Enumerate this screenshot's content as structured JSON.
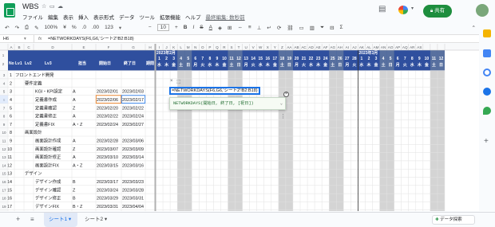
{
  "app": {
    "title": "WBS",
    "menu": [
      "ファイル",
      "編集",
      "表示",
      "挿入",
      "表示形式",
      "データ",
      "ツール",
      "拡張機能",
      "ヘルプ"
    ],
    "last_edit": "最終編集: 数秒前",
    "share_label": "共有"
  },
  "toolbar": {
    "zoom": "100%",
    "font_size": "10",
    "bold": "B",
    "italic": "I",
    "strike": "S",
    "text_color": "A"
  },
  "formula_bar": {
    "cell_ref": "H6",
    "formula": "=NETWORKDAYS(F6,G6,'シート2'!B2:B18)"
  },
  "grid": {
    "col_letters": [
      "A",
      "B",
      "C",
      "D",
      "E",
      "F",
      "G",
      "H",
      "I",
      "J",
      "K",
      "L",
      "M",
      "N",
      "O",
      "P",
      "Q",
      "R",
      "S",
      "T",
      "U",
      "V",
      "W",
      "X",
      "Y",
      "Z",
      "AA",
      "AB",
      "AC",
      "AD",
      "AE",
      "AF",
      "AG",
      "AH",
      "AI",
      "AJ",
      "AK",
      "AL",
      "AM",
      "AN",
      "AO",
      "AP",
      "AQ",
      "AR",
      "AS"
    ],
    "headers": {
      "no": "No",
      "lv1": "Lv1",
      "lv2": "Lv2",
      "lv3": "Lv3",
      "owner": "担当",
      "start": "開始日",
      "end": "終了日",
      "days": "期間"
    },
    "month_1": "2023年2月",
    "month_2": "2023年3月",
    "days_1": [
      "1",
      "2",
      "3",
      "4",
      "5",
      "6",
      "7",
      "8",
      "9",
      "10",
      "11",
      "12",
      "13",
      "14",
      "15",
      "16",
      "17",
      "18",
      "19",
      "20",
      "21",
      "22",
      "23",
      "24",
      "25",
      "26",
      "27",
      "28"
    ],
    "weekdays_1": [
      "水",
      "木",
      "金",
      "土",
      "日",
      "月",
      "火",
      "水",
      "木",
      "金",
      "土",
      "日",
      "月",
      "火",
      "水",
      "木",
      "金",
      "土",
      "日",
      "月",
      "火",
      "水",
      "木",
      "金",
      "土",
      "日",
      "月",
      "火"
    ],
    "days_2": [
      "1",
      "2",
      "3",
      "4",
      "5",
      "6",
      "7",
      "8",
      "9",
      "10",
      "11",
      "12"
    ],
    "weekdays_2": [
      "水",
      "木",
      "金",
      "土",
      "日",
      "月",
      "火",
      "水",
      "木",
      "金",
      "土",
      "日"
    ],
    "rows": [
      {
        "r": "3",
        "no": "1",
        "lv1": "フロントエンド開発",
        "lv2": "",
        "lv3": "",
        "owner": "",
        "start": "",
        "end": ""
      },
      {
        "r": "4",
        "no": "2",
        "lv1": "",
        "lv2": "要件定義",
        "lv3": "",
        "owner": "",
        "start": "",
        "end": ""
      },
      {
        "r": "5",
        "no": "3",
        "lv1": "",
        "lv2": "",
        "lv3": "KGI・KPI設定",
        "owner": "A",
        "start": "2023/02/01",
        "end": "2023/02/03"
      },
      {
        "r": "6",
        "no": "4",
        "lv1": "",
        "lv2": "",
        "lv3": "定義書作成",
        "owner": "A",
        "start": "2023/02/06",
        "end": "2023/02/17"
      },
      {
        "r": "7",
        "no": "5",
        "lv1": "",
        "lv2": "",
        "lv3": "定義書確認",
        "owner": "Z",
        "start": "2023/02/20",
        "end": "2023/02/22"
      },
      {
        "r": "8",
        "no": "6",
        "lv1": "",
        "lv2": "",
        "lv3": "定義書修正",
        "owner": "A",
        "start": "2023/02/22",
        "end": "2023/02/24"
      },
      {
        "r": "9",
        "no": "7",
        "lv1": "",
        "lv2": "",
        "lv3": "定義書FIX",
        "owner": "A・Z",
        "start": "2023/02/24",
        "end": "2023/02/27"
      },
      {
        "r": "10",
        "no": "8",
        "lv1": "",
        "lv2": "画面設計",
        "lv3": "",
        "owner": "",
        "start": "",
        "end": ""
      },
      {
        "r": "11",
        "no": "9",
        "lv1": "",
        "lv2": "",
        "lv3": "画面設計作成",
        "owner": "A",
        "start": "2023/02/28",
        "end": "2023/03/06"
      },
      {
        "r": "12",
        "no": "10",
        "lv1": "",
        "lv2": "",
        "lv3": "画面設計確認",
        "owner": "Z",
        "start": "2023/03/07",
        "end": "2023/03/09"
      },
      {
        "r": "13",
        "no": "11",
        "lv1": "",
        "lv2": "",
        "lv3": "画面設計修正",
        "owner": "A",
        "start": "2023/03/10",
        "end": "2023/03/14"
      },
      {
        "r": "14",
        "no": "12",
        "lv1": "",
        "lv2": "",
        "lv3": "画面設計FIX",
        "owner": "A・Z",
        "start": "2023/03/15",
        "end": "2023/03/16"
      },
      {
        "r": "15",
        "no": "13",
        "lv1": "",
        "lv2": "デザイン",
        "lv3": "",
        "owner": "",
        "start": "",
        "end": ""
      },
      {
        "r": "16",
        "no": "14",
        "lv1": "",
        "lv2": "",
        "lv3": "デザイン作成",
        "owner": "B",
        "start": "2023/03/17",
        "end": "2023/03/23"
      },
      {
        "r": "17",
        "no": "15",
        "lv1": "",
        "lv2": "",
        "lv3": "デザイン確認",
        "owner": "Z",
        "start": "2023/03/24",
        "end": "2023/03/28"
      },
      {
        "r": "18",
        "no": "16",
        "lv1": "",
        "lv2": "",
        "lv3": "デザイン修正",
        "owner": "B",
        "start": "2023/03/29",
        "end": "2023/03/31"
      },
      {
        "r": "19",
        "no": "17",
        "lv1": "",
        "lv2": "",
        "lv3": "デザインFIX",
        "owner": "B・Z",
        "start": "2023/03/31",
        "end": "2023/04/04"
      },
      {
        "r": "20",
        "no": "18",
        "lv1": "",
        "lv2": "コーディング",
        "lv3": "",
        "owner": "",
        "start": "",
        "end": ""
      }
    ]
  },
  "editor": {
    "formula": "=NETWORKDAYS(F6,G6,'シート2'!B2:B18)",
    "close": "×"
  },
  "tooltip": {
    "signature": "NETWORKDAYS(開始日, 終了日, [祝日])"
  },
  "sheets": {
    "tab1": "シート1",
    "tab2": "シート2",
    "explore": "データ探索"
  },
  "colors": {
    "accent": "#1a73e8",
    "header_bg": "#2f4f9e",
    "weekend": "#d4d4d4",
    "share": "#1e8e3e"
  }
}
